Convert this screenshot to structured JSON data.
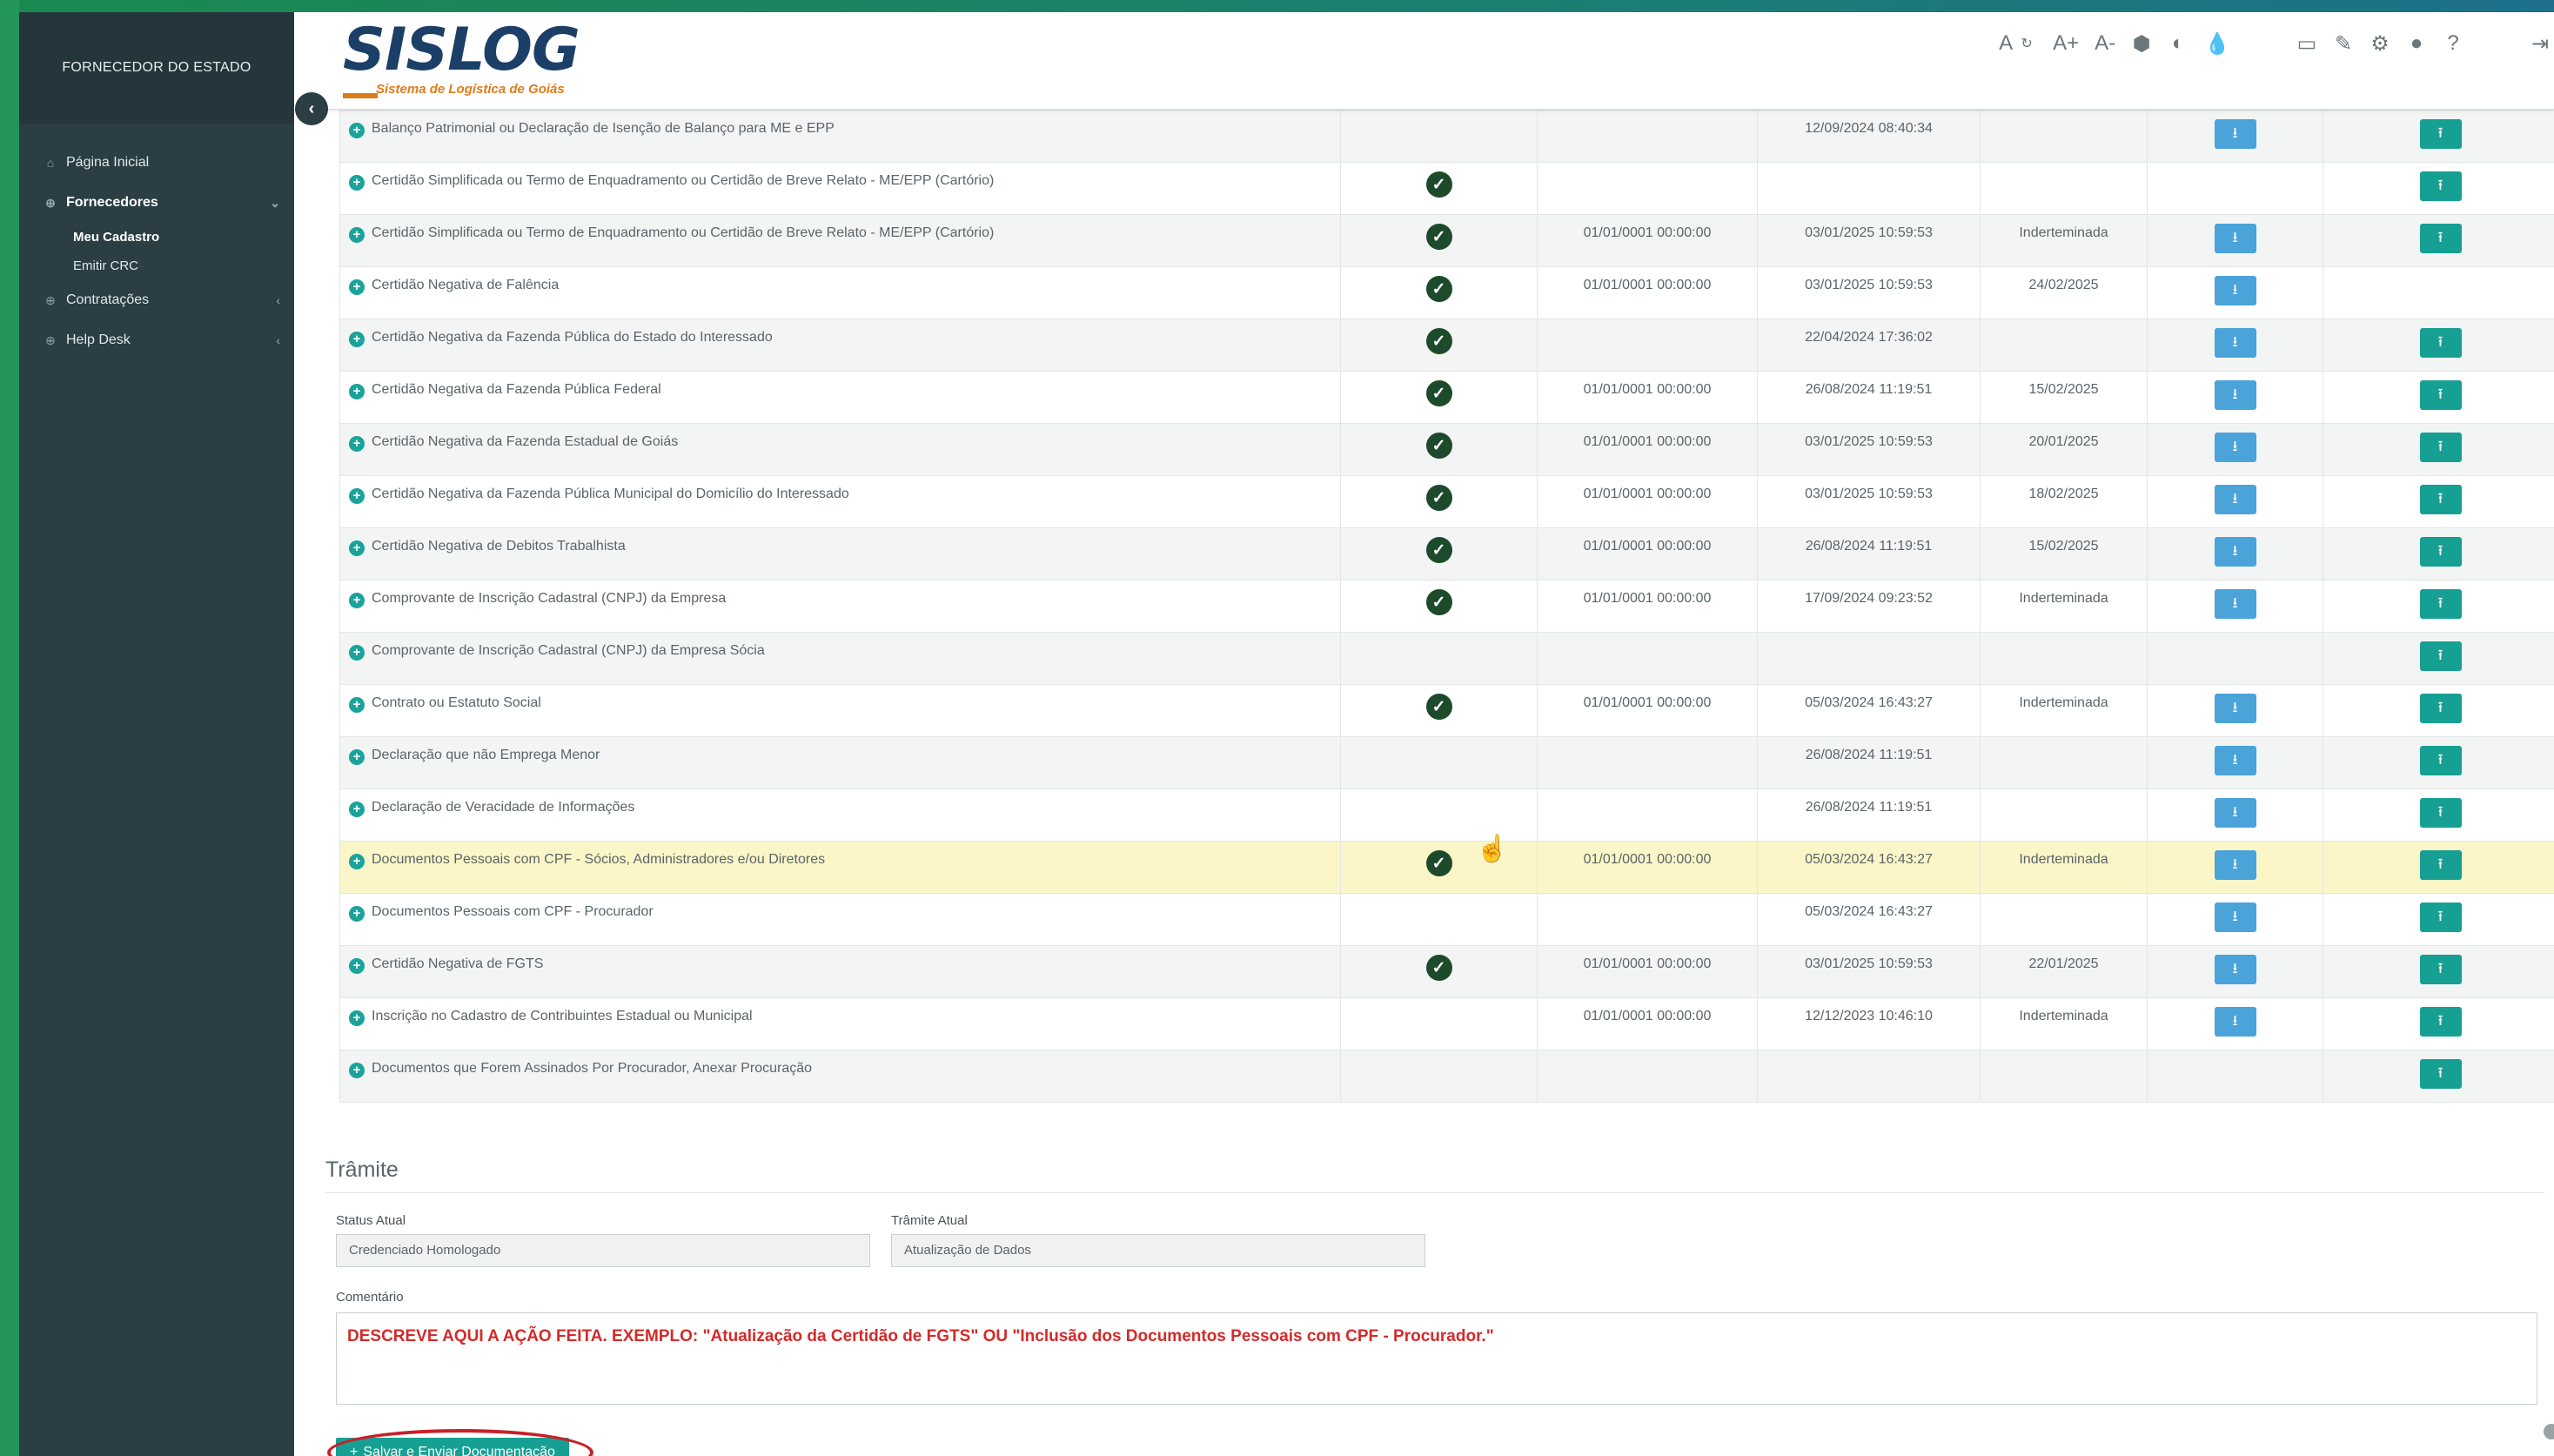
{
  "sidebar": {
    "brand": "FORNECEDOR DO ESTADO",
    "items": [
      {
        "label": "Página Inicial",
        "icon": "home-icon"
      },
      {
        "label": "Fornecedores",
        "icon": "circle-plus-icon"
      },
      {
        "label": "Contratações",
        "icon": "circle-plus-icon"
      },
      {
        "label": "Help Desk",
        "icon": "circle-plus-icon"
      }
    ],
    "subitems": [
      {
        "label": "Meu Cadastro"
      },
      {
        "label": "Emitir CRC"
      }
    ]
  },
  "header": {
    "logo_main": "SISLOG",
    "logo_sub": "Sistema de Logística de Goiás",
    "tools": [
      "A",
      "A+",
      "A-"
    ]
  },
  "documents": [
    {
      "name": "Balanço Patrimonial ou Declaração de Isenção de Balanço para ME e EPP",
      "check": false,
      "emissao": "",
      "envio": "12/09/2024 08:40:34",
      "validade": "",
      "download": true,
      "upload": true,
      "status": "undo"
    },
    {
      "name": "Certidão Simplificada ou Termo de Enquadramento ou Certidão de Breve Relato - ME/EPP (Cartório)",
      "check": true,
      "emissao": "",
      "envio": "",
      "validade": "",
      "download": false,
      "upload": true,
      "status": ""
    },
    {
      "name": "Certidão Simplificada ou Termo de Enquadramento ou Certidão de Breve Relato - ME/EPP (Cartório)",
      "check": true,
      "emissao": "01/01/0001 00:00:00",
      "envio": "03/01/2025 10:59:53",
      "validade": "Inderteminada",
      "download": true,
      "upload": true,
      "status": ""
    },
    {
      "name": "Certidão Negativa de Falência",
      "check": true,
      "emissao": "01/01/0001 00:00:00",
      "envio": "03/01/2025 10:59:53",
      "validade": "24/02/2025",
      "download": true,
      "upload": false,
      "status": ""
    },
    {
      "name": "Certidão Negativa da Fazenda Pública do Estado do Interessado",
      "check": true,
      "emissao": "",
      "envio": "22/04/2024 17:36:02",
      "validade": "",
      "download": true,
      "upload": true,
      "status": ""
    },
    {
      "name": "Certidão Negativa da Fazenda Pública Federal",
      "check": true,
      "emissao": "01/01/0001 00:00:00",
      "envio": "26/08/2024 11:19:51",
      "validade": "15/02/2025",
      "download": true,
      "upload": true,
      "status": ""
    },
    {
      "name": "Certidão Negativa da Fazenda Estadual de Goiás",
      "check": true,
      "emissao": "01/01/0001 00:00:00",
      "envio": "03/01/2025 10:59:53",
      "validade": "20/01/2025",
      "download": true,
      "upload": true,
      "status": "rejected"
    },
    {
      "name": "Certidão Negativa da Fazenda Pública Municipal do Domicílio do Interessado",
      "check": true,
      "emissao": "01/01/0001 00:00:00",
      "envio": "03/01/2025 10:59:53",
      "validade": "18/02/2025",
      "download": true,
      "upload": true,
      "status": ""
    },
    {
      "name": "Certidão Negativa de Debitos Trabalhista",
      "check": true,
      "emissao": "01/01/0001 00:00:00",
      "envio": "26/08/2024 11:19:51",
      "validade": "15/02/2025",
      "download": true,
      "upload": true,
      "status": ""
    },
    {
      "name": "Comprovante de Inscrição Cadastral (CNPJ) da Empresa",
      "check": true,
      "emissao": "01/01/0001 00:00:00",
      "envio": "17/09/2024 09:23:52",
      "validade": "Inderteminada",
      "download": true,
      "upload": true,
      "status": ""
    },
    {
      "name": "Comprovante de Inscrição Cadastral (CNPJ) da Empresa Sócia",
      "check": false,
      "emissao": "",
      "envio": "",
      "validade": "",
      "download": false,
      "upload": true,
      "status": ""
    },
    {
      "name": "Contrato ou Estatuto Social",
      "check": true,
      "emissao": "01/01/0001 00:00:00",
      "envio": "05/03/2024 16:43:27",
      "validade": "Inderteminada",
      "download": true,
      "upload": true,
      "status": ""
    },
    {
      "name": "Declaração que não Emprega Menor",
      "check": false,
      "emissao": "",
      "envio": "26/08/2024 11:19:51",
      "validade": "",
      "download": true,
      "upload": true,
      "status": ""
    },
    {
      "name": "Declaração de Veracidade de Informações",
      "check": false,
      "emissao": "",
      "envio": "26/08/2024 11:19:51",
      "validade": "",
      "download": true,
      "upload": true,
      "status": ""
    },
    {
      "name": "Documentos Pessoais com CPF - Sócios, Administradores e/ou Diretores",
      "check": true,
      "emissao": "01/01/0001 00:00:00",
      "envio": "05/03/2024 16:43:27",
      "validade": "Inderteminada",
      "download": true,
      "upload": true,
      "status": "",
      "highlight": true
    },
    {
      "name": "Documentos Pessoais com CPF - Procurador",
      "check": false,
      "emissao": "",
      "envio": "05/03/2024 16:43:27",
      "validade": "",
      "download": true,
      "upload": true,
      "status": ""
    },
    {
      "name": "Certidão Negativa de FGTS",
      "check": true,
      "emissao": "01/01/0001 00:00:00",
      "envio": "03/01/2025 10:59:53",
      "validade": "22/01/2025",
      "download": true,
      "upload": true,
      "status": "rejected"
    },
    {
      "name": "Inscrição no Cadastro de Contribuintes Estadual ou Municipal",
      "check": false,
      "emissao": "01/01/0001 00:00:00",
      "envio": "12/12/2023 10:46:10",
      "validade": "Inderteminada",
      "download": true,
      "upload": true,
      "status": ""
    },
    {
      "name": "Documentos que Forem Assinados Por Procurador, Anexar Procuração",
      "check": false,
      "emissao": "",
      "envio": "",
      "validade": "",
      "download": false,
      "upload": true,
      "status": ""
    }
  ],
  "tramite": {
    "title": "Trâmite",
    "status_label": "Status Atual",
    "status_value": "Credenciado Homologado",
    "tramite_label": "Trâmite Atual",
    "tramite_value": "Atualização de Dados",
    "comment_label": "Comentário",
    "comment_value": "DESCREVE AQUI A AÇÃO FEITA. EXEMPLO: \"Atualização da Certidão de FGTS\" OU \"Inclusão dos Documentos Pessoais com CPF - Procurador.\"",
    "save_label": "Salvar e Enviar Documentação"
  },
  "colors": {
    "accent_teal": "#16a093",
    "download_blue": "#4aa3d9",
    "check_green": "#1e4a2c",
    "reject_red": "#d42a2a",
    "undo_orange": "#f0a12a",
    "sidebar_bg": "#2a3e44",
    "highlight_row": "#fbf6c8"
  }
}
